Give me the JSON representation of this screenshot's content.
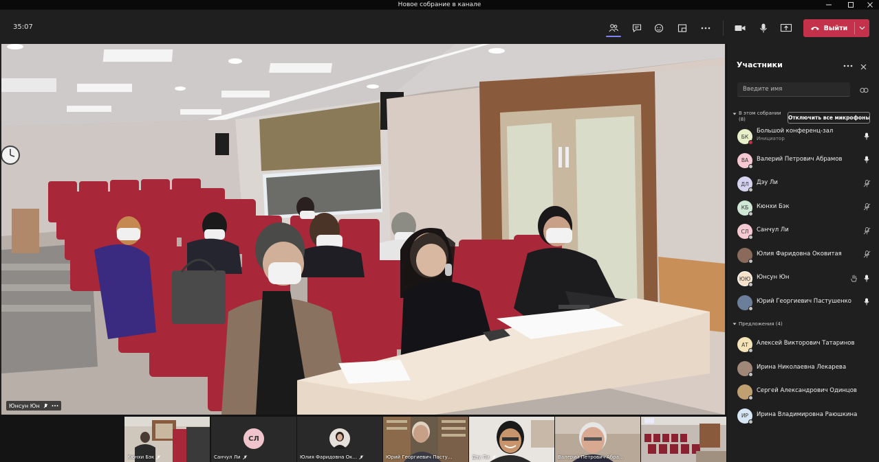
{
  "window": {
    "title": "Новое собрание в канале"
  },
  "toolbar": {
    "timer": "35:07",
    "leave_label": "Выйти"
  },
  "main_video": {
    "name": "Юнсун Юн"
  },
  "thumbnails": [
    {
      "name": "Кюнхи Бэк",
      "avatar": "",
      "type": "video"
    },
    {
      "name": "Санчул Ли",
      "avatar": "СЛ",
      "type": "avatar",
      "color": "#f0c4cc"
    },
    {
      "name": "Юлия Фаридовна Ок...",
      "avatar": "",
      "type": "photo"
    },
    {
      "name": "Юрий Георгиевич Пасту...",
      "avatar": "",
      "type": "video"
    },
    {
      "name": "Дэу Ли",
      "avatar": "",
      "type": "video"
    },
    {
      "name": "Валерий Петрович Абра...",
      "avatar": "",
      "type": "video"
    },
    {
      "name": "",
      "avatar": "",
      "type": "video"
    }
  ],
  "panel": {
    "title": "Участники",
    "search_placeholder": "Введите имя",
    "in_meeting_label": "В этом собрании",
    "in_meeting_count": "(8)",
    "mute_all_label": "Отключить все микрофоны",
    "suggestions_label": "Предложения (4)",
    "participants": [
      {
        "initials": "БК",
        "name": "Большой конференц-зал",
        "role": "Инициатор",
        "color": "#e7f0c8",
        "mic": "on",
        "status": "#c4314b"
      },
      {
        "initials": "ВА",
        "name": "Валерий Петрович Абрамов",
        "role": "",
        "color": "#f6c9d2",
        "mic": "on",
        "status": "#c4c4c4"
      },
      {
        "initials": "ДЛ",
        "name": "Дэу Ли",
        "role": "",
        "color": "#d6d3f0",
        "mic": "off",
        "status": "#c4c4c4"
      },
      {
        "initials": "КБ",
        "name": "Кюнхи Бэк",
        "role": "",
        "color": "#cfe8d6",
        "mic": "off",
        "status": "#c4c4c4"
      },
      {
        "initials": "СЛ",
        "name": "Санчул Ли",
        "role": "",
        "color": "#f6c9d2",
        "mic": "off",
        "status": "#c4c4c4"
      },
      {
        "initials": "",
        "name": "Юлия Фаридовна Оковитая",
        "role": "",
        "color": "#8a6a5a",
        "mic": "off",
        "status": "#c4c4c4"
      },
      {
        "initials": "ЮЮ",
        "name": "Юнсун Юн",
        "role": "",
        "color": "#f5e1c8",
        "mic": "on",
        "status": "#c4c4c4",
        "hand": true
      },
      {
        "initials": "",
        "name": "Юрий Георгиевич Пастушенко",
        "role": "",
        "color": "#6b7f9a",
        "mic": "on",
        "status": "#c4c4c4"
      }
    ],
    "suggestions": [
      {
        "initials": "АТ",
        "name": "Алексей Викторович Татаринов",
        "color": "#f5e3b8"
      },
      {
        "initials": "",
        "name": "Ирина Николаевна Лекарева",
        "color": "#a08878"
      },
      {
        "initials": "",
        "name": "Сергей Александрович Одинцов",
        "color": "#c0a070"
      },
      {
        "initials": "ИР",
        "name": "Ирина Владимировна Раюшкина",
        "color": "#d6e6f5"
      }
    ]
  },
  "colors": {
    "accent": "#7f85f5",
    "leave": "#c4314b",
    "background": "#1f1f1f"
  }
}
